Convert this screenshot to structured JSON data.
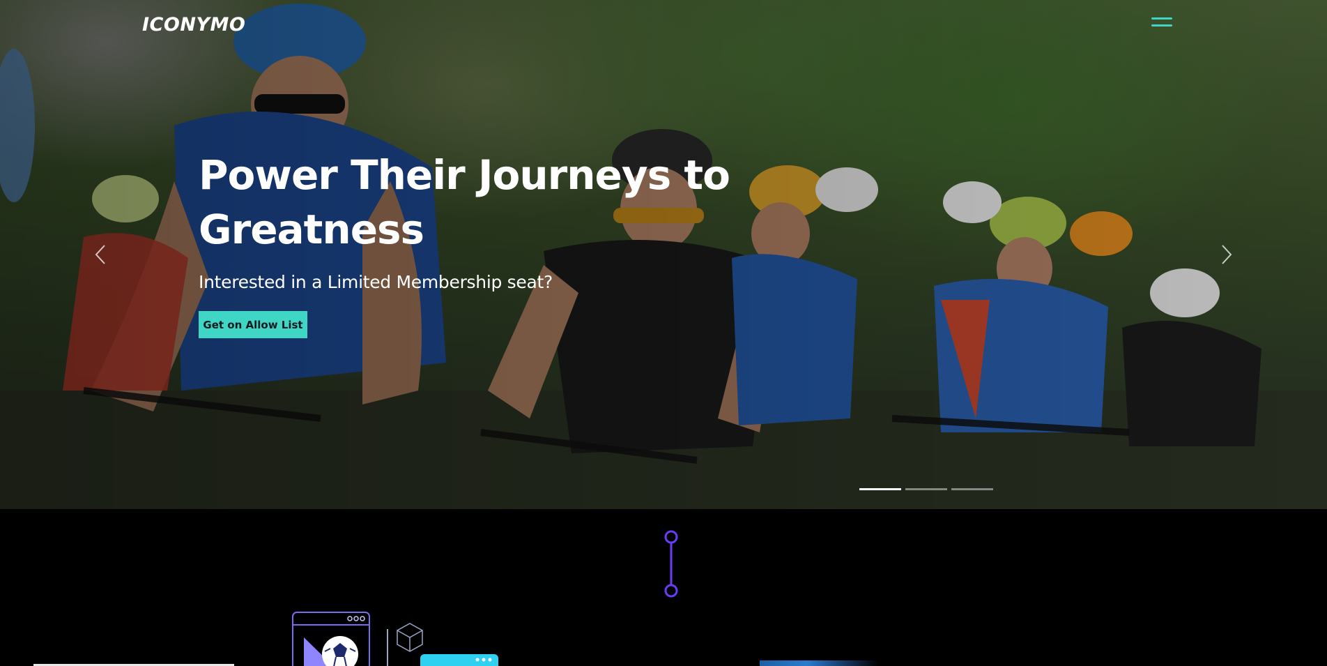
{
  "header": {
    "logo_text": "ICONYMO",
    "menu_icon": "hamburger-menu-icon"
  },
  "hero": {
    "title": "Power Their Journeys to Greatness",
    "subtitle": "Interested in a Limited Membership seat?",
    "cta_label": "Get on Allow List",
    "prev_icon": "chevron-left-icon",
    "next_icon": "chevron-right-icon",
    "slide_count": 3,
    "active_slide": 1
  },
  "colors": {
    "accent": "#3fd6c6",
    "connector": "#6b3cf5",
    "background": "#000000"
  }
}
